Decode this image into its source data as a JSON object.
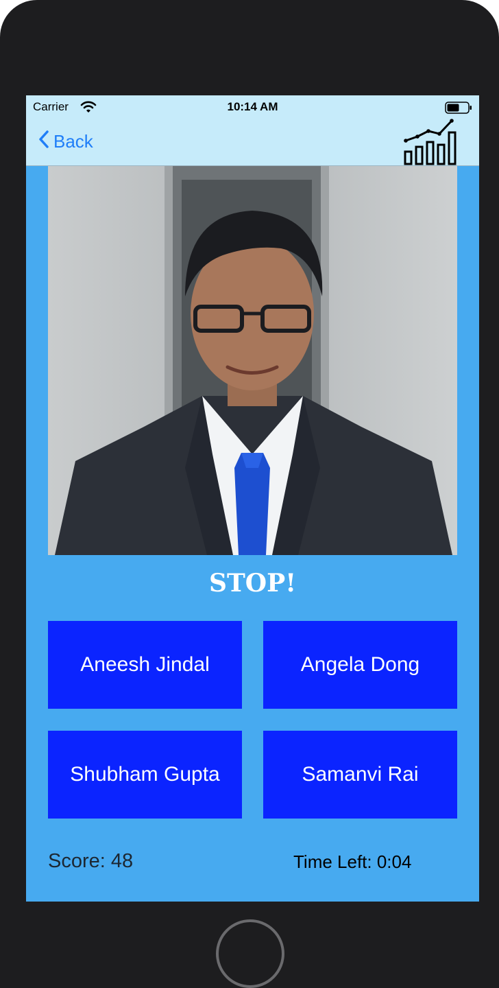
{
  "status_bar": {
    "carrier": "Carrier",
    "time": "10:14 AM",
    "icons": [
      "wifi-icon",
      "battery-icon"
    ]
  },
  "nav": {
    "back_label": "Back",
    "back_icon": "chevron-left-icon",
    "stats_icon": "bar-chart-trend-icon"
  },
  "game": {
    "headline": "STOP!",
    "answers": [
      "Aneesh Jindal",
      "Angela Dong",
      "Shubham Gupta",
      "Samanvi Rai"
    ],
    "score_label": "Score: 48",
    "time_left": "Time Left: 0:04"
  },
  "colors": {
    "background": "#47aaf0",
    "navbar": "#c6ebfa",
    "answer_button": "#0b24ff",
    "accent": "#1f7ef8",
    "device_bezel": "#1d1d1f"
  }
}
